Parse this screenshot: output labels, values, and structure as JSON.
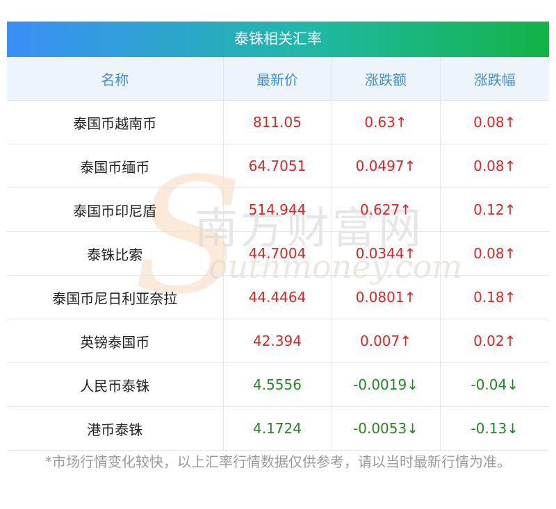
{
  "title": "泰铢相关汇率",
  "headers": [
    "名称",
    "最新价",
    "涨跌额",
    "涨跌幅"
  ],
  "rows": [
    {
      "name": "泰国币越南币",
      "price": "811.05",
      "change": "0.63↑",
      "pct": "0.08↑",
      "dir": "up"
    },
    {
      "name": "泰国币缅币",
      "price": "64.7051",
      "change": "0.0497↑",
      "pct": "0.08↑",
      "dir": "up"
    },
    {
      "name": "泰国币印尼盾",
      "price": "514.944",
      "change": "0.627↑",
      "pct": "0.12↑",
      "dir": "up"
    },
    {
      "name": "泰铢比索",
      "price": "44.7004",
      "change": "0.0344↑",
      "pct": "0.08↑",
      "dir": "up"
    },
    {
      "name": "泰国币尼日利亚奈拉",
      "price": "44.4464",
      "change": "0.0801↑",
      "pct": "0.18↑",
      "dir": "up"
    },
    {
      "name": "英镑泰国币",
      "price": "42.394",
      "change": "0.007↑",
      "pct": "0.02↑",
      "dir": "up"
    },
    {
      "name": "人民币泰铢",
      "price": "4.5556",
      "change": "-0.0019↓",
      "pct": "-0.04↓",
      "dir": "down"
    },
    {
      "name": "港币泰铢",
      "price": "4.1724",
      "change": "-0.0053↓",
      "pct": "-0.13↓",
      "dir": "down"
    }
  ],
  "footnote": "*市场行情变化较快，以上汇率行情数据仅供参考，请以当时最新行情为准。",
  "watermark": {
    "cn": "南方财富网",
    "en": "outhmoney.com",
    "logo": "S"
  },
  "colors": {
    "up": "#e62222",
    "down": "#1f8a1f",
    "header_text": "#3d8ee8",
    "header_bg": "#edf4fc"
  }
}
